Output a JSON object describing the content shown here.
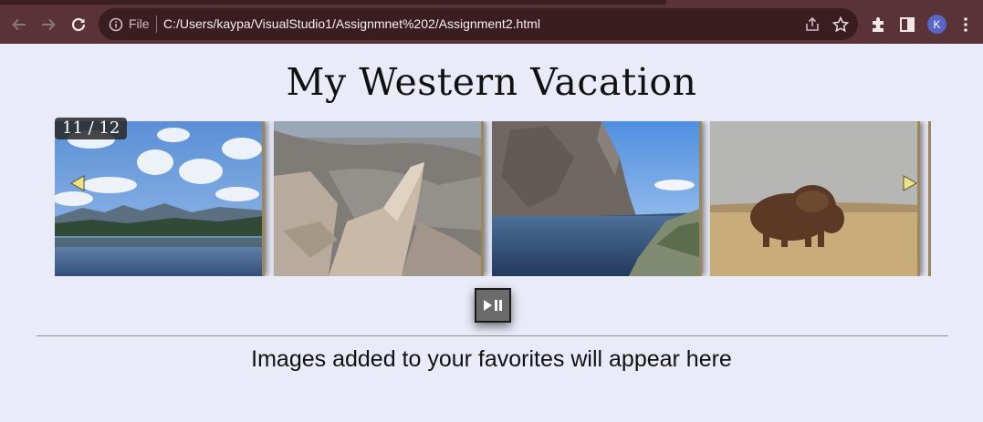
{
  "browser": {
    "address_prefix": "File",
    "url": "C:/Users/kaypa/VisualStudio1/Assignmnet%202/Assignment2.html",
    "profile_initial": "K",
    "icons": [
      "back-arrow-icon",
      "forward-arrow-icon",
      "reload-icon",
      "info-icon",
      "share-icon",
      "star-icon",
      "extensions-icon",
      "sidepanel-icon",
      "kebab-menu-icon"
    ]
  },
  "page": {
    "title": "My Western Vacation",
    "gallery": {
      "counter": "11 / 12",
      "current_index": 11,
      "total": 12,
      "slides": [
        {
          "name": "mountain-lake-reflection"
        },
        {
          "name": "rocky-cliff-overlook"
        },
        {
          "name": "alpine-lake-cliffs"
        },
        {
          "name": "bison-prairie"
        }
      ]
    },
    "play_pause_label": "play-pause-icon",
    "favorites_message": "Images added to your favorites will appear here"
  },
  "colors": {
    "page_bg": "#e9ebf8",
    "toolbar_bg": "#5a3338",
    "omnibox_bg": "#3a1d21",
    "arrow_yellow": "#efe38a",
    "frame_gold": "#9b8759"
  }
}
